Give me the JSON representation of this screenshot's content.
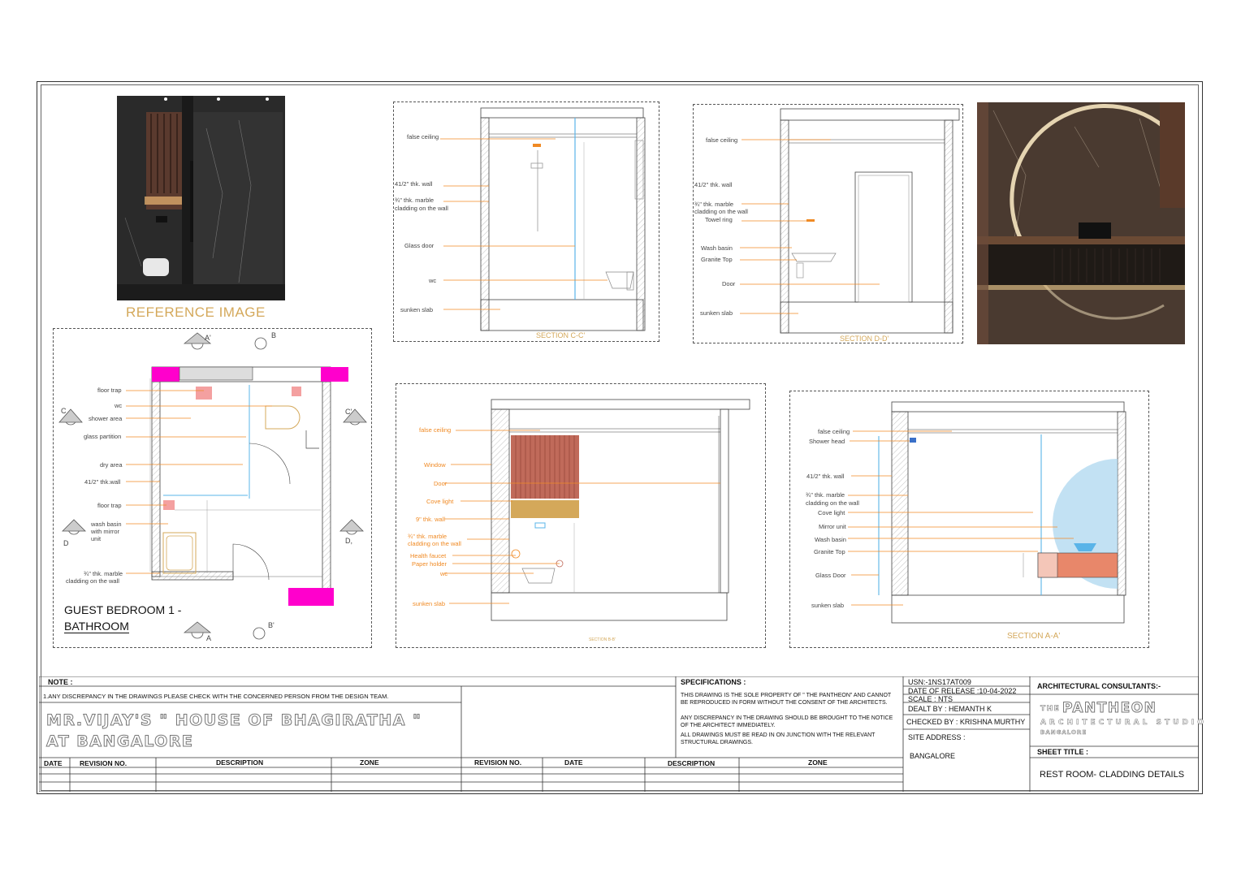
{
  "reference_image_title": "REFERENCE IMAGE",
  "plan": {
    "title_line1": "GUEST BEDROOM 1 -",
    "title_line2": "BATHROOM",
    "markers": {
      "A_top": "A'",
      "B_top": "B",
      "C_left": "C",
      "C_right": "C'",
      "D_left": "D",
      "D_right": "D,",
      "A_bottom": "A",
      "B_bottom": "B'"
    },
    "labels": [
      "floor trap",
      "wc",
      "shower area",
      "glass partition",
      "dry area",
      "41/2\" thk.wall",
      "floor trap",
      "wash basin",
      "with mirror",
      "unit",
      "¾\" thk. marble",
      "cladding on the wall"
    ]
  },
  "section_cc": {
    "title": "SECTION C-C'",
    "labels": [
      "false ceiling",
      "41/2\" thk. wall",
      "¾\" thk. marble",
      "cladding on the wall",
      "Glass door",
      "wc",
      "sunken slab"
    ]
  },
  "section_dd": {
    "title": "SECTION D-D'",
    "labels": [
      "false ceiling",
      "41/2\" thk. wall",
      "¾\" thk. marble",
      "cladding on the wall",
      "Towel ring",
      "Wash basin",
      "Granite Top",
      "Door",
      "sunken slab"
    ]
  },
  "section_bb": {
    "title": "SECTION B-B'",
    "labels": [
      "false ceiling",
      "Window",
      "Door",
      "Cove light",
      "9\" thk. wall",
      "¾\" thk. marble",
      "cladding on the wall",
      "Health faucet",
      "Paper holder",
      "wc",
      "sunken slab"
    ]
  },
  "section_aa": {
    "title": "SECTION A-A'",
    "labels": [
      "false ceiling",
      "Shower head",
      "41/2\" thk. wall",
      "¾\" thk. marble",
      "cladding on the wall",
      "Cove light",
      "Mirror unit",
      "Wash basin",
      "Granite Top",
      "Glass Door",
      "sunken slab"
    ]
  },
  "title_block": {
    "note_header": "NOTE :",
    "note_text": "1.ANY DISCREPANCY IN THE DRAWINGS PLEASE CHECK WITH THE CONCERNED PERSON FROM THE DESIGN TEAM.",
    "project_line1": "MR.VIJAY'S \" HOUSE OF BHAGIRATHA \"",
    "project_line2": "AT BANGALORE",
    "spec_header": "SPECIFICATIONS :",
    "spec_1": "THIS DRAWING IS THE SOLE PROPERTY OF \" THE PANTHEON\" AND CANNOT BE REPRODUCED IN FORM WITHOUT THE CONSENT OF THE ARCHITECTS.",
    "spec_2": "ANY DISCREPANCY IN THE DRAWING SHOULD BE BROUGHT TO THE NOTICE OF THE ARCHITECT IMMEDIATELY.",
    "spec_3": "ALL DRAWINGS MUST BE READ IN ON JUNCTION WITH THE RELEVANT STRUCTURAL DRAWINGS.",
    "usn": "USN:-1NS17AT009",
    "release": "DATE OF RELEASE :10-04-2022",
    "scale": "SCALE : NTS",
    "dealt": "DEALT BY : HEMANTH K",
    "checked": "CHECKED BY : KRISHNA MURTHY",
    "site_header": "SITE ADDRESS :",
    "site": "BANGALORE",
    "consultants_header": "ARCHITECTURAL CONSULTANTS:-",
    "firm_the": "THE",
    "firm_name": "PANTHEON",
    "firm_sub": "ARCHITECTURAL STUDIO",
    "firm_city": "BANGALORE",
    "sheet_title_header": "SHEET TITLE :",
    "sheet_title": "REST ROOM- CLADDING DETAILS",
    "rev_headers": [
      "DATE",
      "REVISION NO.",
      "DESCRIPTION",
      "ZONE",
      "REVISION NO.",
      "DATE",
      "DESCRIPTION",
      "ZONE"
    ]
  },
  "colors": {
    "gold": "#d4a85a",
    "leader": "#f08a24",
    "magenta": "#ff00cc",
    "blue": "#5ab4e8",
    "pink": "#f4a0a0",
    "timber": "#c06a5a"
  }
}
